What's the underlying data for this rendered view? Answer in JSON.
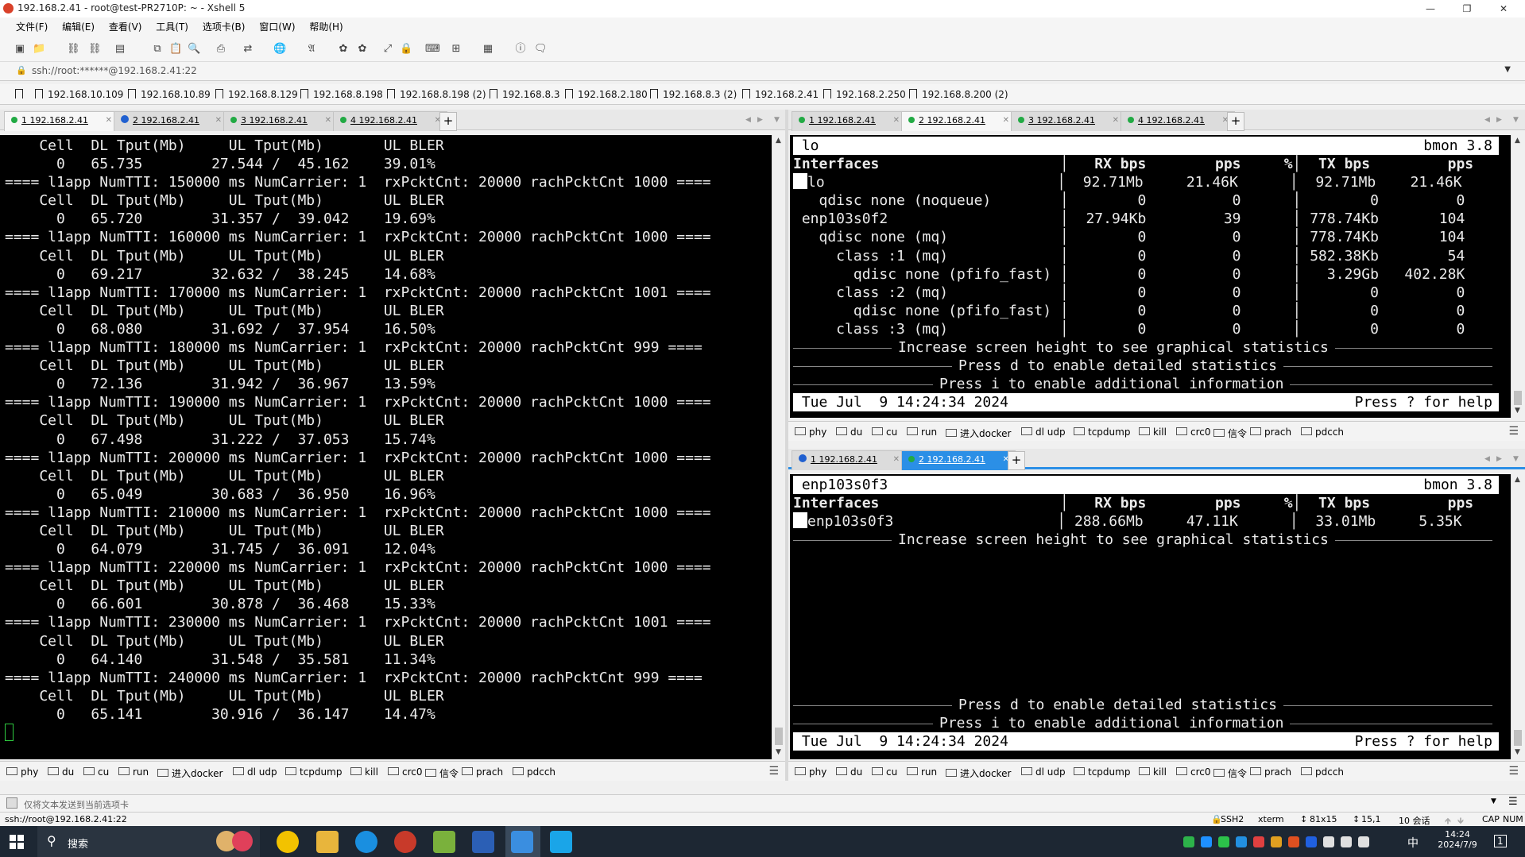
{
  "window": {
    "title": "192.168.2.41 - root@test-PR2710P: ~ - Xshell 5"
  },
  "menu": [
    "文件(F)",
    "编辑(E)",
    "查看(V)",
    "工具(T)",
    "选项卡(B)",
    "窗口(W)",
    "帮助(H)"
  ],
  "address": {
    "value": "ssh://root:******@192.168.2.41:22"
  },
  "bookmarks": [
    "192.168.10.109",
    "192.168.10.89",
    "192.168.8.129",
    "192.168.8.198",
    "192.168.8.198 (2)",
    "192.168.8.3",
    "192.168.2.180",
    "192.168.8.3 (2)",
    "192.168.2.41",
    "192.168.2.250",
    "192.168.8.200 (2)"
  ],
  "left_tabs": [
    "1 192.168.2.41",
    "2 192.168.2.41",
    "3 192.168.2.41",
    "4 192.168.2.41"
  ],
  "right_top_tabs": [
    "1 192.168.2.41",
    "2 192.168.2.41",
    "3 192.168.2.41",
    "4 192.168.2.41"
  ],
  "right_bottom_tabs": [
    "1 192.168.2.41",
    "2 192.168.2.41"
  ],
  "left_terminal": [
    "    Cell  DL Tput(Mb)     UL Tput(Mb)       UL BLER",
    "      0   65.735        27.544 /  45.162    39.01%",
    "==== l1app NumTTI: 150000 ms NumCarrier: 1  rxPcktCnt: 20000 rachPcktCnt 1000 ====",
    "    Cell  DL Tput(Mb)     UL Tput(Mb)       UL BLER",
    "      0   65.720        31.357 /  39.042    19.69%",
    "==== l1app NumTTI: 160000 ms NumCarrier: 1  rxPcktCnt: 20000 rachPcktCnt 1000 ====",
    "    Cell  DL Tput(Mb)     UL Tput(Mb)       UL BLER",
    "      0   69.217        32.632 /  38.245    14.68%",
    "==== l1app NumTTI: 170000 ms NumCarrier: 1  rxPcktCnt: 20000 rachPcktCnt 1001 ====",
    "    Cell  DL Tput(Mb)     UL Tput(Mb)       UL BLER",
    "      0   68.080        31.692 /  37.954    16.50%",
    "==== l1app NumTTI: 180000 ms NumCarrier: 1  rxPcktCnt: 20000 rachPcktCnt 999 ====",
    "    Cell  DL Tput(Mb)     UL Tput(Mb)       UL BLER",
    "      0   72.136        31.942 /  36.967    13.59%",
    "==== l1app NumTTI: 190000 ms NumCarrier: 1  rxPcktCnt: 20000 rachPcktCnt 1000 ====",
    "    Cell  DL Tput(Mb)     UL Tput(Mb)       UL BLER",
    "      0   67.498        31.222 /  37.053    15.74%",
    "==== l1app NumTTI: 200000 ms NumCarrier: 1  rxPcktCnt: 20000 rachPcktCnt 1000 ====",
    "    Cell  DL Tput(Mb)     UL Tput(Mb)       UL BLER",
    "      0   65.049        30.683 /  36.950    16.96%",
    "==== l1app NumTTI: 210000 ms NumCarrier: 1  rxPcktCnt: 20000 rachPcktCnt 1000 ====",
    "    Cell  DL Tput(Mb)     UL Tput(Mb)       UL BLER",
    "      0   64.079        31.745 /  36.091    12.04%",
    "==== l1app NumTTI: 220000 ms NumCarrier: 1  rxPcktCnt: 20000 rachPcktCnt 1000 ====",
    "    Cell  DL Tput(Mb)     UL Tput(Mb)       UL BLER",
    "      0   66.601        30.878 /  36.468    15.33%",
    "==== l1app NumTTI: 230000 ms NumCarrier: 1  rxPcktCnt: 20000 rachPcktCnt 1001 ====",
    "    Cell  DL Tput(Mb)     UL Tput(Mb)       UL BLER",
    "      0   64.140        31.548 /  35.581    11.34%",
    "==== l1app NumTTI: 240000 ms NumCarrier: 1  rxPcktCnt: 20000 rachPcktCnt 999 ====",
    "    Cell  DL Tput(Mb)     UL Tput(Mb)       UL BLER",
    "      0   65.141        30.916 /  36.147    14.47%"
  ],
  "bmon_top": {
    "iface": "lo",
    "version": "bmon 3.8",
    "header": [
      "Interfaces",
      "RX bps",
      "pps",
      "%",
      "TX bps",
      "pps",
      "%"
    ],
    "rows": [
      [
        "lo",
        "92.71Mb",
        "21.46K",
        "92.71Mb",
        "21.46K"
      ],
      [
        "  qdisc none (noqueue)",
        "0",
        "0",
        "0",
        "0"
      ],
      [
        "enp103s0f2",
        "27.94Kb",
        "39",
        "778.74Kb",
        "104"
      ],
      [
        "  qdisc none (mq)",
        "0",
        "0",
        "778.74Kb",
        "104"
      ],
      [
        "    class :1 (mq)",
        "0",
        "0",
        "582.38Kb",
        "54"
      ],
      [
        "      qdisc none (pfifo_fast)",
        "0",
        "0",
        "3.29Gb",
        "402.28K"
      ],
      [
        "    class :2 (mq)",
        "0",
        "0",
        "0",
        "0"
      ],
      [
        "      qdisc none (pfifo_fast)",
        "0",
        "0",
        "0",
        "0"
      ],
      [
        "    class :3 (mq)",
        "0",
        "0",
        "0",
        "0"
      ]
    ],
    "msg_graph": "Increase screen height to see graphical statistics",
    "msg_d": "Press d to enable detailed statistics",
    "msg_i": "Press i to enable additional information",
    "date": "Tue Jul  9 14:24:34 2024",
    "help": "Press ? for help"
  },
  "bmon_bottom": {
    "iface": "enp103s0f3",
    "version": "bmon 3.8",
    "header": [
      "Interfaces",
      "RX bps",
      "pps",
      "%",
      "TX bps",
      "pps",
      "%"
    ],
    "rows": [
      [
        "enp103s0f3",
        "288.66Mb",
        "47.11K",
        "33.01Mb",
        "5.35K"
      ]
    ],
    "msg_graph": "Increase screen height to see graphical statistics",
    "msg_d": "Press d to enable detailed statistics",
    "msg_i": "Press i to enable additional information",
    "date": "Tue Jul  9 14:24:34 2024",
    "help": "Press ? for help"
  },
  "quick_commands": [
    "phy",
    "du",
    "cu",
    "run",
    "进入docker",
    "dl udp",
    "tcpdump",
    "kill",
    "crc0",
    "信令",
    "prach",
    "pdcch"
  ],
  "sendbar": {
    "text": "仅将文本发送到当前选项卡"
  },
  "status": {
    "left": "ssh://root@192.168.2.41:22",
    "protocol": "SSH2",
    "term": "xterm",
    "size": "81x15",
    "pos": "15,1",
    "sessions": "10 会话",
    "caps": "CAP",
    "num": "NUM"
  },
  "taskbar": {
    "search": "搜索",
    "time": "14:24",
    "date": "2024/7/9",
    "ime": "中",
    "notif": "1"
  }
}
